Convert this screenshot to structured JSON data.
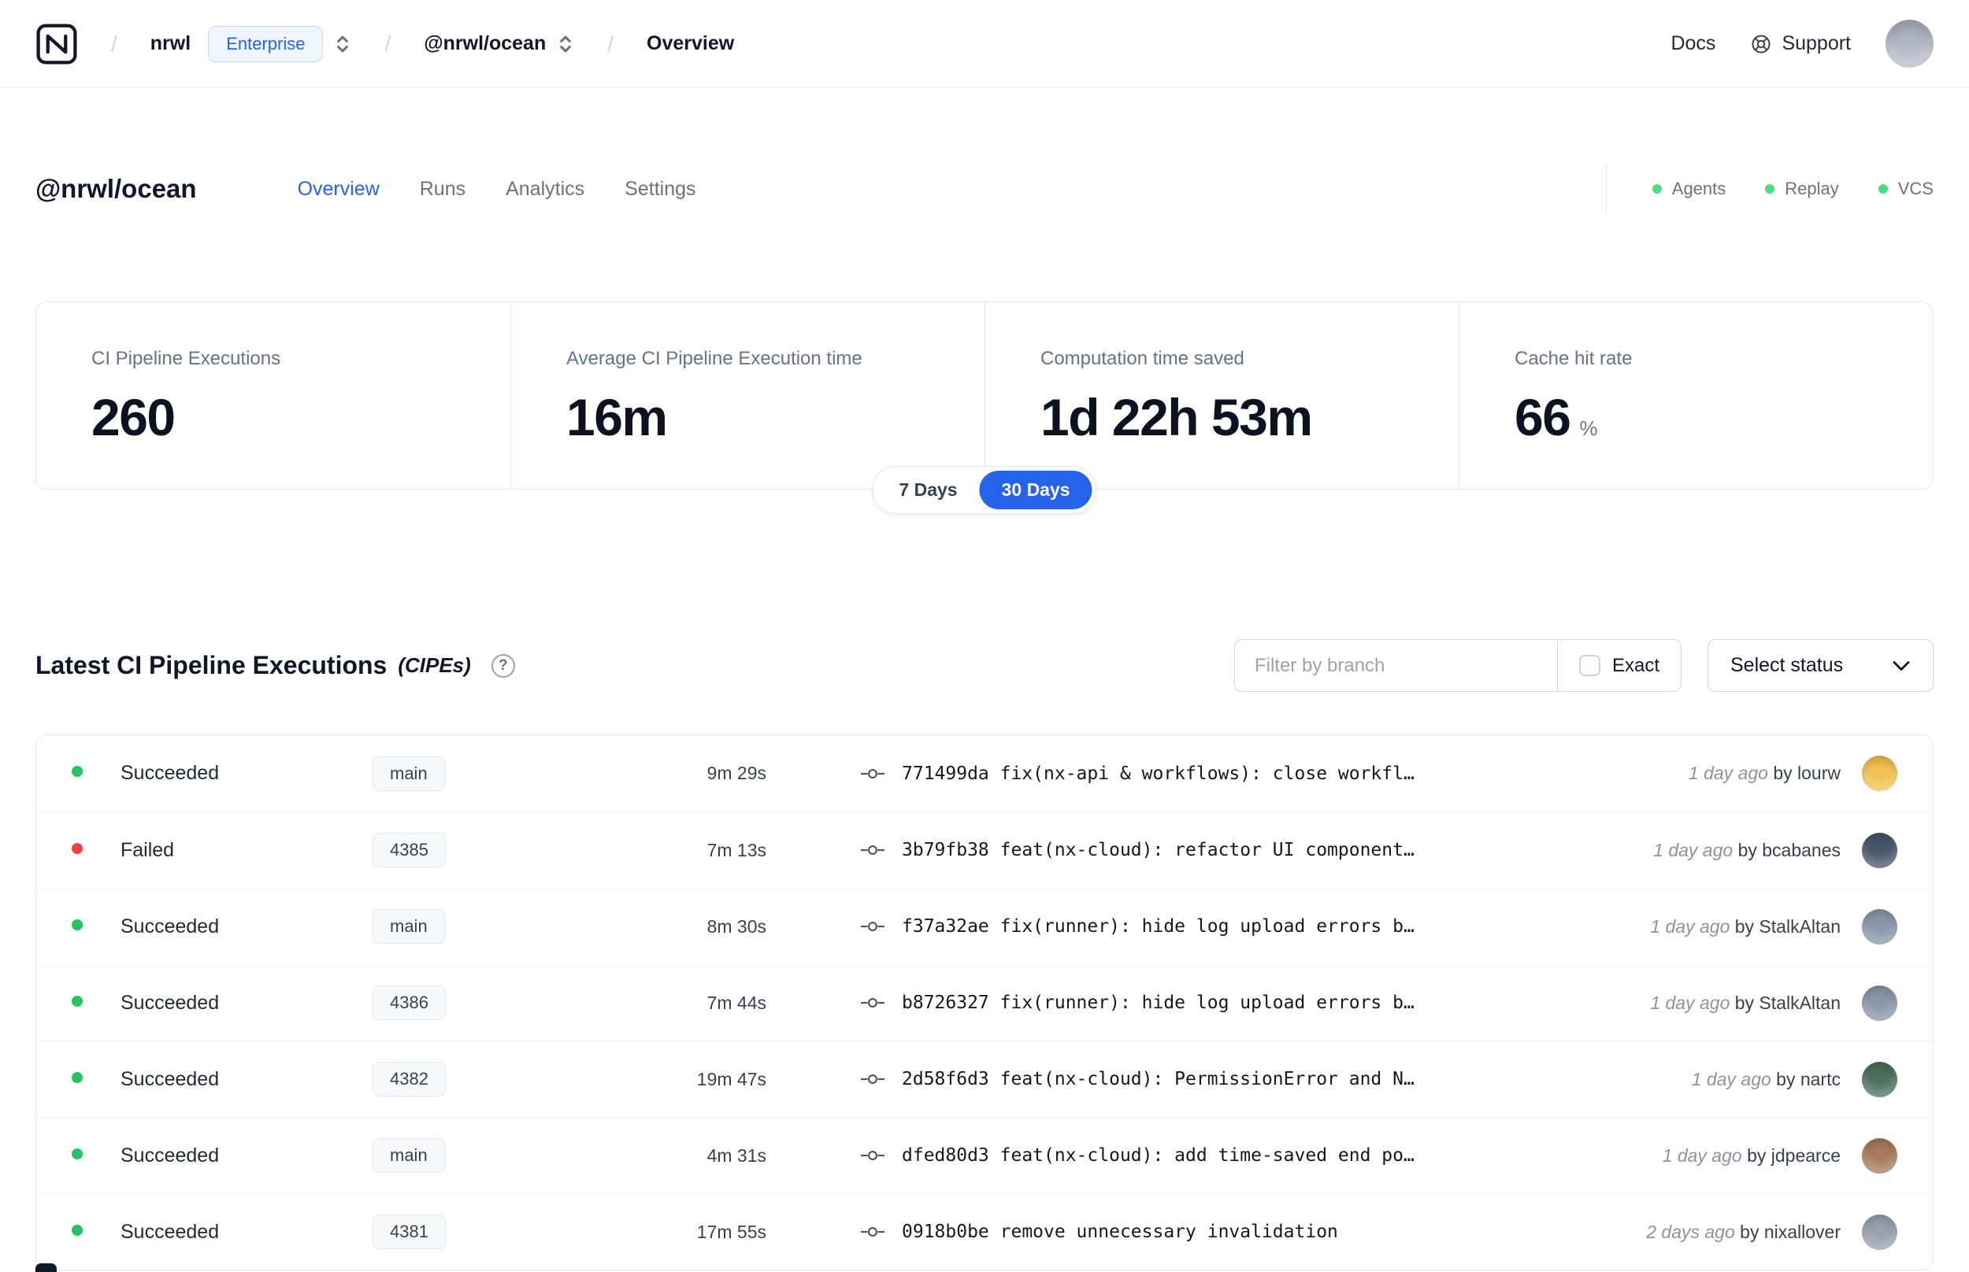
{
  "navbar": {
    "breadcrumb": {
      "separator": "/",
      "org": "nrwl",
      "org_badge": "Enterprise",
      "workspace": "@nrwl/ocean",
      "page": "Overview"
    },
    "docs": "Docs",
    "support": "Support",
    "avatar_color": "#aeb6c2"
  },
  "workspace": {
    "title": "@nrwl/ocean",
    "tabs": [
      {
        "label": "Overview",
        "active": true
      },
      {
        "label": "Runs",
        "active": false
      },
      {
        "label": "Analytics",
        "active": false
      },
      {
        "label": "Settings",
        "active": false
      }
    ],
    "indicator_color": "#4ade80",
    "indicators": [
      {
        "label": "Agents"
      },
      {
        "label": "Replay"
      },
      {
        "label": "VCS"
      }
    ]
  },
  "stats": {
    "cards": [
      {
        "label": "CI Pipeline Executions",
        "value": "260"
      },
      {
        "label": "Average CI Pipeline Execution time",
        "value": "16m"
      },
      {
        "label": "Computation time saved",
        "value": "1d 22h 53m"
      },
      {
        "label": "Cache hit rate",
        "value": "66",
        "suffix": "%"
      }
    ],
    "toggle": {
      "options": [
        "7 Days",
        "30 Days"
      ],
      "active": "30 Days"
    }
  },
  "cipes": {
    "title": "Latest CI Pipeline Executions",
    "suffix": "(CIPEs)",
    "help": "?",
    "filter_placeholder": "Filter by branch",
    "exact": "Exact",
    "select_status": "Select status",
    "status_colors": {
      "succeeded": "#22c55e",
      "failed": "#ef4444"
    },
    "rows": [
      {
        "status": "Succeeded",
        "status_color": "#22c55e",
        "branch": "main",
        "duration": "9m 29s",
        "commit": "771499da fix(nx-api & workflows): close workfl…",
        "time": "1 day ago",
        "author": "by lourw",
        "avatar_color": "#f2c14e"
      },
      {
        "status": "Failed",
        "status_color": "#ef4444",
        "branch": "4385",
        "duration": "7m 13s",
        "commit": "3b79fb38 feat(nx-cloud): refactor UI component…",
        "time": "1 day ago",
        "author": "by bcabanes",
        "avatar_color": "#475569"
      },
      {
        "status": "Succeeded",
        "status_color": "#22c55e",
        "branch": "main",
        "duration": "8m 30s",
        "commit": "f37a32ae fix(runner): hide log upload errors b…",
        "time": "1 day ago",
        "author": "by StalkAltan",
        "avatar_color": "#8a97a8"
      },
      {
        "status": "Succeeded",
        "status_color": "#22c55e",
        "branch": "4386",
        "duration": "7m 44s",
        "commit": "b8726327 fix(runner): hide log upload errors b…",
        "time": "1 day ago",
        "author": "by StalkAltan",
        "avatar_color": "#8a97a8"
      },
      {
        "status": "Succeeded",
        "status_color": "#22c55e",
        "branch": "4382",
        "duration": "19m 47s",
        "commit": "2d58f6d3 feat(nx-cloud): PermissionError and N…",
        "time": "1 day ago",
        "author": "by nartc",
        "avatar_color": "#49705c"
      },
      {
        "status": "Succeeded",
        "status_color": "#22c55e",
        "branch": "main",
        "duration": "4m 31s",
        "commit": "dfed80d3 feat(nx-cloud): add time-saved end po…",
        "time": "1 day ago",
        "author": "by jdpearce",
        "avatar_color": "#a8795a"
      },
      {
        "status": "Succeeded",
        "status_color": "#22c55e",
        "branch": "4381",
        "duration": "17m 55s",
        "commit": "0918b0be remove unnecessary invalidation",
        "time": "2 days ago",
        "author": "by nixallover",
        "avatar_color": "#97a0ac"
      }
    ]
  }
}
